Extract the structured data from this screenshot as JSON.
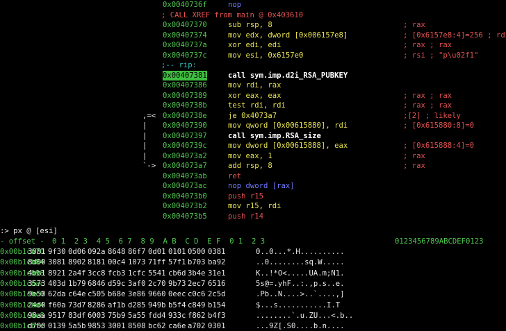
{
  "disasm": [
    {
      "addr": "0x0040736f",
      "asm": "nop",
      "asm_color": "b"
    },
    {
      "xref": "; CALL XREF from main @ 0x403610"
    },
    {
      "addr": "0x00407370",
      "asm": "sub rsp, 8",
      "comment": "; rax"
    },
    {
      "addr": "0x00407374",
      "asm": "mov edx, dword [0x006157e8]",
      "comment": "; [0x6157e8:4]=256 ; rdx"
    },
    {
      "addr": "0x0040737a",
      "asm": "xor edi, edi",
      "comment": "; rax ; rax"
    },
    {
      "addr": "0x0040737c",
      "asm": "mov esi, 0x6157e0",
      "comment": "; rsi ; \"p\\u02f1\""
    },
    {
      "label": ";-- rip:"
    },
    {
      "addr": "0x00407381",
      "asm": "call sym.imp.d2i_RSA_PUBKEY",
      "highlight": true,
      "asm_color": "gb"
    },
    {
      "addr": "0x00407386",
      "asm": "mov rdi, rax"
    },
    {
      "addr": "0x00407389",
      "asm": "xor eax, eax",
      "comment": "; rax ; rax"
    },
    {
      "addr": "0x0040738b",
      "asm": "test rdi, rdi",
      "comment": "; rax ; rax"
    },
    {
      "flow": ",=<",
      "addr": "0x0040738e",
      "asm": "je 0x4073a7",
      "comment": ";[2] ; likely"
    },
    {
      "flow": "|",
      "addr": "0x00407390",
      "asm": "mov qword [0x00615880], rdi",
      "comment": "; [0x615880:8]=0"
    },
    {
      "flow": "|",
      "addr": "0x00407397",
      "asm": "call sym.imp.RSA_size",
      "asm_color": "gb"
    },
    {
      "flow": "|",
      "addr": "0x0040739c",
      "asm": "mov dword [0x00615888], eax",
      "comment": "; [0x615888:4]=0"
    },
    {
      "flow": "|",
      "addr": "0x004073a2",
      "asm": "mov eax, 1",
      "comment": "; rax"
    },
    {
      "flow": "`->",
      "addr": "0x004073a7",
      "asm": "add rsp, 8",
      "comment": "; rax"
    },
    {
      "addr": "0x004073ab",
      "asm": "ret",
      "asm_color": "r"
    },
    {
      "addr": "0x004073ac",
      "asm": "nop dword [rax]",
      "asm_color": "b"
    },
    {
      "addr": "0x004073b0",
      "asm": "push r15",
      "asm_color": "r"
    },
    {
      "addr": "0x004073b2",
      "asm": "mov r15, rdi"
    },
    {
      "addr": "0x004073b5",
      "asm": "push r14",
      "asm_color": "r"
    }
  ],
  "prompt": ":> px @ [esi]",
  "hex_header": {
    "offset": "- offset -",
    "cols": "0 1  2 3  4 5  6 7  8 9  A B  C D  E F  0 1  2 3",
    "ascii": "0123456789ABCDEF0123"
  },
  "hex_rows": [
    {
      "addr": "0x00b1cb70",
      "groups": [
        "3081",
        "9f30",
        "0d06",
        "092a",
        "8648",
        "86f7",
        "0d01",
        "0101",
        "0500",
        "0381"
      ],
      "ascii": "0..0...*.H.........."
    },
    {
      "addr": "0x00b1cb84",
      "groups": [
        "8d00",
        "3081",
        "8902",
        "8181",
        "00c4",
        "1073",
        "71ff",
        "57f1",
        "b703",
        "ba92"
      ],
      "ascii": "..0........sq.W....."
    },
    {
      "addr": "0x00b1cb98",
      "groups": [
        "4bb1",
        "8921",
        "2a4f",
        "3cc8",
        "fcb3",
        "1cfc",
        "5541",
        "cb6d",
        "3b4e",
        "31e1"
      ],
      "ascii": "K..!*O<.....UA.m;N1."
    },
    {
      "addr": "0x00b1cbac",
      "groups": [
        "3573",
        "403d",
        "1b79",
        "6846",
        "d59c",
        "3af0",
        "2c70",
        "9b73",
        "2ec7",
        "6516"
      ],
      "ascii": "5s@=.yhF..:.,p.s..e."
    },
    {
      "addr": "0x00b1cbc0",
      "groups": [
        "9e50",
        "62da",
        "c64e",
        "c505",
        "b68e",
        "3e86",
        "9660",
        "0eec",
        "c0c6",
        "2c5d"
      ],
      "ascii": ".Pb..N....>..`....,]"
    },
    {
      "addr": "0x00b1cbd4",
      "groups": [
        "24d0",
        "f60a",
        "73d7",
        "8286",
        "af1b",
        "d285",
        "949b",
        "b5f4",
        "c849",
        "b154"
      ],
      "ascii": "$...s...........I.T"
    },
    {
      "addr": "0x00b1cbe8",
      "groups": [
        "98aa",
        "9517",
        "83df",
        "6003",
        "75b9",
        "5a55",
        "fdd4",
        "933c",
        "f862",
        "b4f3"
      ],
      "ascii": "........`.u.ZU...<.b.."
    },
    {
      "addr": "0x00b1cbfc",
      "groups": [
        "d700",
        "0139",
        "5a5b",
        "9853",
        "3001",
        "8508",
        "bc62",
        "ca6e",
        "a702",
        "0301"
      ],
      "ascii": "...9Z[.S0....b.n...."
    }
  ]
}
